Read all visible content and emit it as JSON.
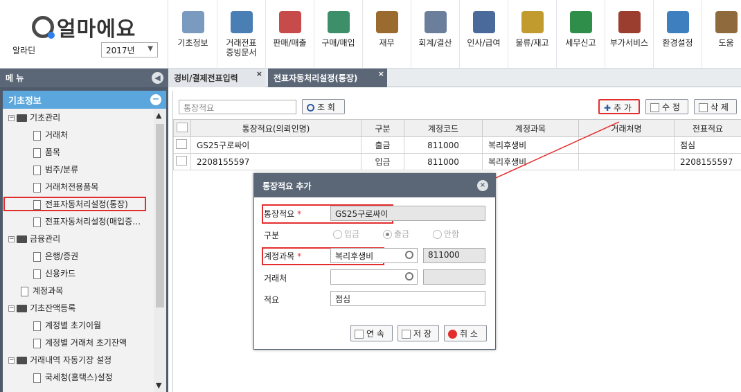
{
  "brand": {
    "name": "얼마에요"
  },
  "company": {
    "name": "알라딘",
    "year": "2017년"
  },
  "menu": [
    {
      "label": "기초정보",
      "icon": "ledger-icon"
    },
    {
      "label": "거래전표\n증빙문서",
      "icon": "voucher-icon"
    },
    {
      "label": "판매/매출",
      "icon": "sales-icon"
    },
    {
      "label": "구매/매입",
      "icon": "purchase-icon"
    },
    {
      "label": "재무",
      "icon": "money-bag-icon"
    },
    {
      "label": "회계/결산",
      "icon": "accounting-icon"
    },
    {
      "label": "인사/급여",
      "icon": "hr-icon"
    },
    {
      "label": "물류/재고",
      "icon": "logistics-icon"
    },
    {
      "label": "세무신고",
      "icon": "tax-icon"
    },
    {
      "label": "부가서비스",
      "icon": "bank-icon"
    },
    {
      "label": "환경설정",
      "icon": "gear-icon"
    },
    {
      "label": "도움",
      "icon": "help-book-icon"
    }
  ],
  "sidebar": {
    "header": "메 뉴",
    "section": "기초정보",
    "tree": [
      {
        "label": "기초관리",
        "type": "folder",
        "level": 0
      },
      {
        "label": "거래처",
        "type": "doc",
        "level": 1
      },
      {
        "label": "품목",
        "type": "doc",
        "level": 1
      },
      {
        "label": "범주/분류",
        "type": "doc",
        "level": 1
      },
      {
        "label": "거래처전용품목",
        "type": "doc",
        "level": 1
      },
      {
        "label": "전표자동처리설정(통장)",
        "type": "doc",
        "level": 1,
        "selected": true
      },
      {
        "label": "전표자동처리설정(매입증…",
        "type": "doc",
        "level": 1
      },
      {
        "label": "금융관리",
        "type": "folder",
        "level": 0
      },
      {
        "label": "은행/증권",
        "type": "doc",
        "level": 1
      },
      {
        "label": "신용카드",
        "type": "doc",
        "level": 1
      },
      {
        "label": "계정과목",
        "type": "doc",
        "level": 0
      },
      {
        "label": "기초잔액등록",
        "type": "folder",
        "level": 0
      },
      {
        "label": "계정별 초기이월",
        "type": "doc",
        "level": 1
      },
      {
        "label": "계정별 거래처 초기잔액",
        "type": "doc",
        "level": 1
      },
      {
        "label": "거래내역 자동기장 설정",
        "type": "folder",
        "level": 0
      },
      {
        "label": "국세청(홈택스)설정",
        "type": "doc",
        "level": 1
      }
    ]
  },
  "tabs": [
    {
      "label": "경비/결제전표입력"
    },
    {
      "label": "전표자동처리설정(통장)"
    }
  ],
  "toolbar": {
    "search_placeholder": "통장적요",
    "query": "조 회",
    "add": "추 가",
    "edit": "수 정",
    "delete": "삭 제"
  },
  "table": {
    "columns": [
      "통장적요(의뢰인명)",
      "구분",
      "계정코드",
      "계정과목",
      "거래처명",
      "전표적요"
    ],
    "rows": [
      [
        "GS25구로싸이",
        "출금",
        "811000",
        "복리후생비",
        "",
        "점심"
      ],
      [
        "2208155597",
        "입금",
        "811000",
        "복리후생비",
        "",
        "2208155597"
      ]
    ]
  },
  "dialog": {
    "title": "통장적요 추가",
    "field_memo_label": "통장적요",
    "field_memo_value": "GS25구로싸이",
    "field_type_label": "구분",
    "type_options": [
      "입금",
      "출금",
      "안함"
    ],
    "field_account_label": "계정과목",
    "account_name": "복리후생비",
    "account_code": "811000",
    "field_partner_label": "거래처",
    "field_summary_label": "적요",
    "summary_value": "점심",
    "btn_continue": "연 속",
    "btn_save": "저 장",
    "btn_cancel": "취 소",
    "required_mark": "*"
  },
  "close_glyph": "×",
  "colors": {
    "highlight": "#e32d2d",
    "header": "#5b6777",
    "accent": "#5aa6dd"
  }
}
